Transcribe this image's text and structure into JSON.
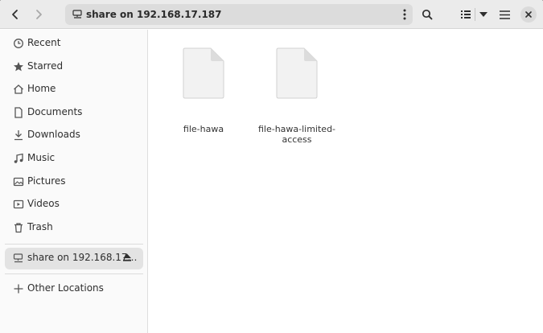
{
  "header": {
    "back_icon": "go-previous-icon",
    "forward_icon": "go-next-icon",
    "location": "share on 192.168.17.187",
    "location_icon": "network-drive-icon",
    "location_menu_icon": "view-more-icon",
    "search_icon": "search-icon",
    "view_icon": "view-list-icon",
    "view_options_icon": "pan-down-icon",
    "main_menu_icon": "open-menu-icon",
    "close_icon": "close-icon"
  },
  "sidebar": {
    "places": [
      {
        "label": "Recent",
        "icon": "recent-icon"
      },
      {
        "label": "Starred",
        "icon": "starred-icon"
      },
      {
        "label": "Home",
        "icon": "home-icon"
      },
      {
        "label": "Documents",
        "icon": "documents-icon"
      },
      {
        "label": "Downloads",
        "icon": "downloads-icon"
      },
      {
        "label": "Music",
        "icon": "music-icon"
      },
      {
        "label": "Pictures",
        "icon": "pictures-icon"
      },
      {
        "label": "Videos",
        "icon": "videos-icon"
      },
      {
        "label": "Trash",
        "icon": "trash-icon"
      }
    ],
    "mounts": [
      {
        "label": "share on 192.168.17…",
        "icon": "network-drive-icon",
        "eject_icon": "eject-icon",
        "selected": true
      }
    ],
    "other_locations": {
      "label": "Other Locations",
      "icon": "add-icon"
    }
  },
  "files": [
    {
      "name": "file-hawa",
      "icon": "text-file-icon"
    },
    {
      "name": "file-hawa-limited-\naccess",
      "icon": "text-file-icon"
    }
  ],
  "colors": {
    "headerbar": "#ebebeb",
    "pathbar": "#dcdcdc",
    "sidebar": "#fafafa",
    "selected": "#e3e3e3",
    "file_icon": "#f2f2f2"
  }
}
